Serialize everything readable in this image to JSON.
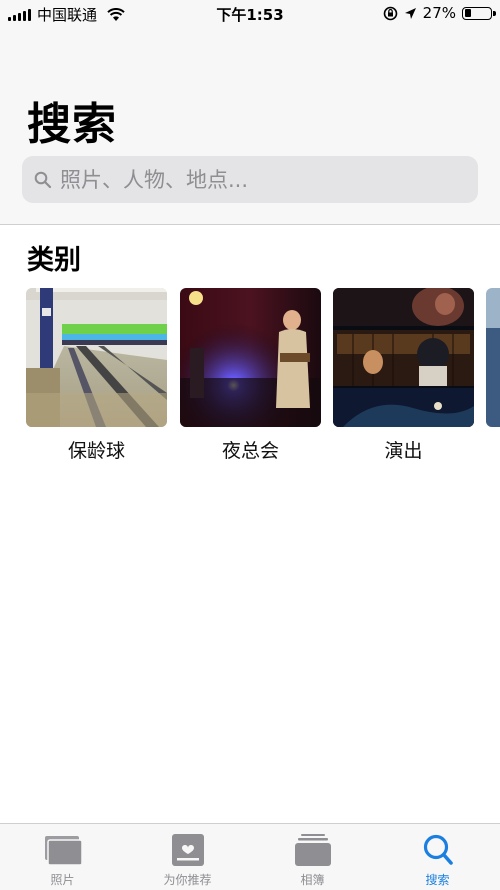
{
  "status_bar": {
    "carrier": "中国联通",
    "time": "下午1:53",
    "battery_percent": "27%",
    "battery_level": 0.27
  },
  "header": {
    "title": "搜索"
  },
  "search": {
    "placeholder": "照片、人物、地点..."
  },
  "categories": {
    "title": "类别",
    "items": [
      {
        "label": "保龄球",
        "icon": "bowling-thumbnail"
      },
      {
        "label": "夜总会",
        "icon": "nightclub-thumbnail"
      },
      {
        "label": "演出",
        "icon": "performance-thumbnail"
      }
    ]
  },
  "tabbar": {
    "items": [
      {
        "label": "照片",
        "icon": "photos-icon",
        "active": false
      },
      {
        "label": "为你推荐",
        "icon": "for-you-icon",
        "active": false
      },
      {
        "label": "相簿",
        "icon": "albums-icon",
        "active": false
      },
      {
        "label": "搜索",
        "icon": "search-icon",
        "active": true
      }
    ],
    "active_color": "#1a7fe0",
    "inactive_color": "#8e8e93"
  }
}
